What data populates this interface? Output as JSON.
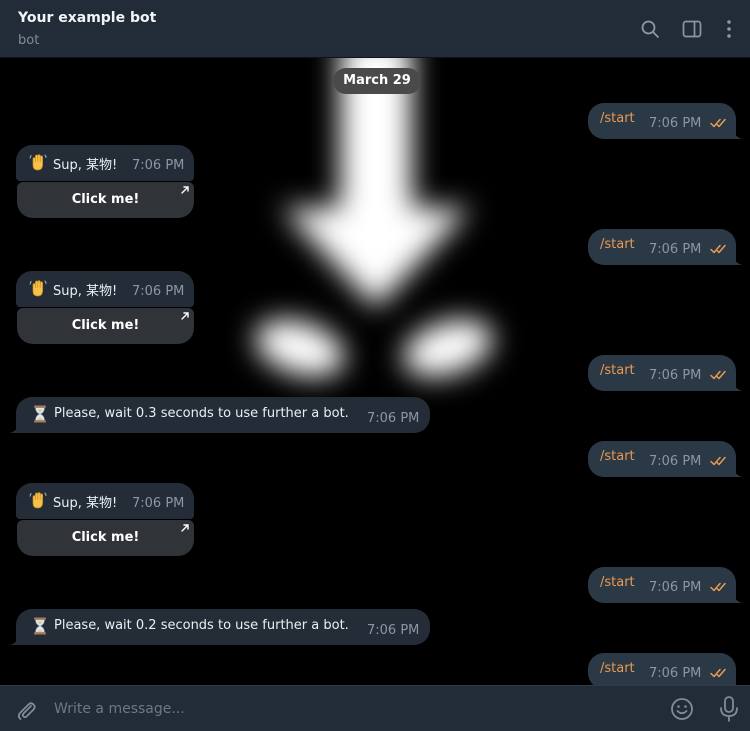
{
  "header": {
    "title": "Your example bot",
    "status": "bot",
    "icons": [
      "search-icon",
      "sidebar-toggle-icon",
      "more-vertical-icon"
    ]
  },
  "chat": {
    "date_label": "March 29",
    "messages": [
      {
        "type": "outgoing",
        "text": "/start",
        "time": "7:06 PM"
      },
      {
        "type": "incoming",
        "emoji": "waving-hand",
        "text": "Sup, 某物!",
        "time": "7:06 PM",
        "button": "Click me!"
      },
      {
        "type": "outgoing",
        "text": "/start",
        "time": "7:06 PM"
      },
      {
        "type": "incoming",
        "emoji": "waving-hand",
        "text": "Sup, 某物!",
        "time": "7:06 PM",
        "button": "Click me!"
      },
      {
        "type": "outgoing",
        "text": "/start",
        "time": "7:06 PM"
      },
      {
        "type": "incoming",
        "emoji": "hourglass",
        "text": "Please, wait 0.3 seconds to use further a bot.",
        "time": "7:06 PM"
      },
      {
        "type": "outgoing",
        "text": "/start",
        "time": "7:06 PM"
      },
      {
        "type": "incoming",
        "emoji": "waving-hand",
        "text": "Sup, 某物!",
        "time": "7:06 PM",
        "button": "Click me!"
      },
      {
        "type": "outgoing",
        "text": "/start",
        "time": "7:06 PM"
      },
      {
        "type": "incoming",
        "emoji": "hourglass",
        "text": "Please, wait 0.2 seconds to use further a bot.",
        "time": "7:06 PM"
      },
      {
        "type": "outgoing",
        "text": "/start",
        "time": "7:06 PM"
      }
    ]
  },
  "composer": {
    "placeholder": "Write a message...",
    "icons": [
      "attach-icon",
      "emoji-icon",
      "microphone-icon"
    ]
  },
  "colors": {
    "header_bg": "#212c38",
    "chat_bg": "#000000",
    "outgoing_bubble": "#2b3845",
    "incoming_bubble": "#242d37",
    "command_text": "#e79a52",
    "read_checks": "#e79a52",
    "inline_button": "#303438"
  }
}
